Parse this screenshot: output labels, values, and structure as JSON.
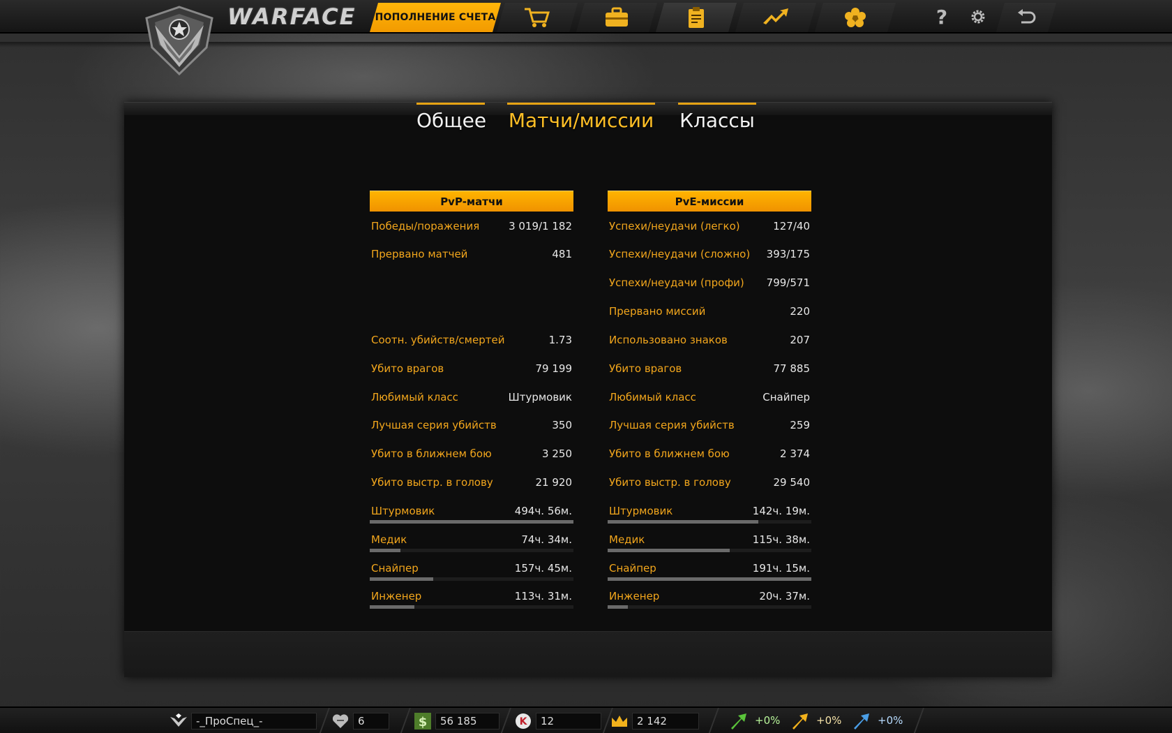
{
  "header": {
    "logo_text": "WARFACE",
    "topup_label": "ПОПОЛНЕНИЕ СЧЕТА",
    "help_label": "?"
  },
  "tabs": [
    {
      "label": "Общее",
      "active": false
    },
    {
      "label": "Матчи/миссии",
      "active": true
    },
    {
      "label": "Классы",
      "active": false
    }
  ],
  "pvp": {
    "title": "PvP-матчи",
    "rows": [
      {
        "label": "Победы/поражения",
        "value": "3 019/1 182"
      },
      {
        "label": "Прервано матчей",
        "value": "481"
      },
      {
        "label": "Соотн. убийств/смертей",
        "value": "1.73"
      },
      {
        "label": "Убито врагов",
        "value": "79 199"
      },
      {
        "label": "Любимый класс",
        "value": "Штурмовик"
      },
      {
        "label": "Лучшая серия убийств",
        "value": "350"
      },
      {
        "label": "Убито в ближнем бою",
        "value": "3 250"
      },
      {
        "label": "Убито выстр. в голову",
        "value": "21 920"
      }
    ],
    "classes": [
      {
        "label": "Штурмовик",
        "value": "494ч. 56м.",
        "progress": 1.0
      },
      {
        "label": "Медик",
        "value": "74ч. 34м.",
        "progress": 0.15
      },
      {
        "label": "Снайпер",
        "value": "157ч. 45м.",
        "progress": 0.31
      },
      {
        "label": "Инженер",
        "value": "113ч. 31м.",
        "progress": 0.22
      }
    ]
  },
  "pve": {
    "title": "PvE-миссии",
    "rows": [
      {
        "label": "Успехи/неудачи (легко)",
        "value": "127/40"
      },
      {
        "label": "Успехи/неудачи (сложно)",
        "value": "393/175"
      },
      {
        "label": "Успехи/неудачи (профи)",
        "value": "799/571"
      },
      {
        "label": "Прервано миссий",
        "value": "220"
      },
      {
        "label": "Использовано знаков",
        "value": "207"
      },
      {
        "label": "Убито врагов",
        "value": "77 885"
      },
      {
        "label": "Любимый класс",
        "value": "Снайпер"
      },
      {
        "label": "Лучшая серия убийств",
        "value": "259"
      },
      {
        "label": "Убито в ближнем бою",
        "value": "2 374"
      },
      {
        "label": "Убито выстр. в голову",
        "value": "29 540"
      }
    ],
    "classes": [
      {
        "label": "Штурмовик",
        "value": "142ч. 19м.",
        "progress": 0.74
      },
      {
        "label": "Медик",
        "value": "115ч. 38м.",
        "progress": 0.6
      },
      {
        "label": "Снайпер",
        "value": "191ч. 15м.",
        "progress": 1.0
      },
      {
        "label": "Инженер",
        "value": "20ч. 37м.",
        "progress": 0.1
      }
    ]
  },
  "status_bar": {
    "nickname": "-_ПроСпец_-",
    "rank_points": "6",
    "money": "56 185",
    "kredits": "12",
    "crowns": "2 142",
    "bonus_green": "+0%",
    "bonus_yellow": "+0%",
    "bonus_blue": "+0%"
  },
  "colors": {
    "accent": "#f2a61c",
    "header_orange": "#ffb400"
  }
}
